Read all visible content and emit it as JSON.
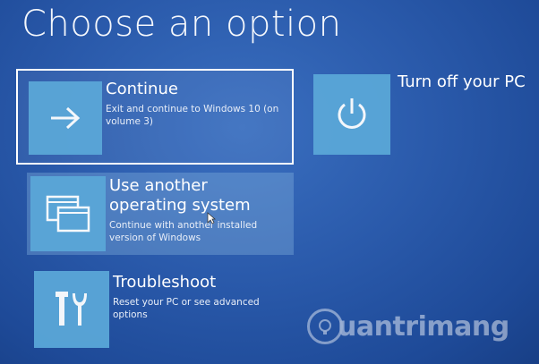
{
  "page": {
    "title": "Choose an option"
  },
  "options": {
    "continue": {
      "label": "Continue",
      "description": "Exit and continue to Windows 10 (on volume 3)",
      "icon": "arrow-right-icon"
    },
    "other_os": {
      "label": "Use another operating system",
      "description": "Continue with another installed version of Windows",
      "icon": "windows-stack-icon"
    },
    "troubleshoot": {
      "label": "Troubleshoot",
      "description": "Reset your PC or see advanced options",
      "icon": "tools-icon"
    },
    "turn_off": {
      "label": "Turn off your PC",
      "icon": "power-icon"
    }
  },
  "watermark": {
    "text": "uantrimang"
  },
  "colors": {
    "background": "#2a5aab",
    "tile": "#5aa7d8",
    "text": "#ffffff"
  }
}
